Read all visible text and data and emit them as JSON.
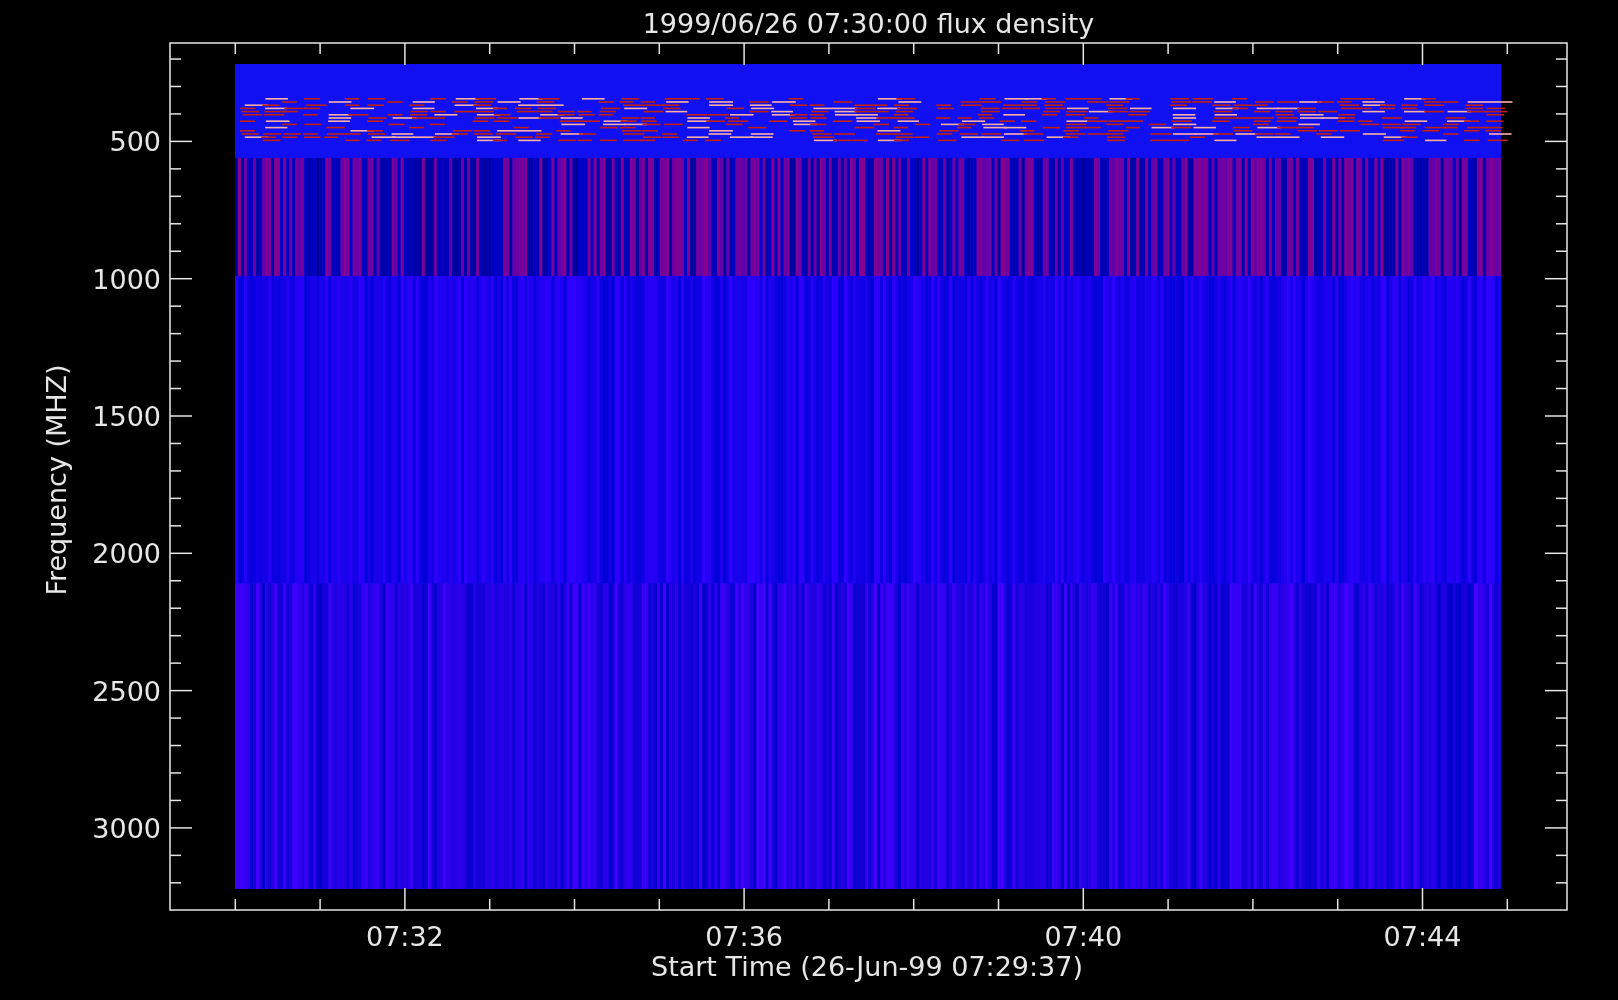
{
  "title": "1999/06/26 07:30:00 flux density",
  "y_axis": {
    "label": "Frequency (MHZ)",
    "ticks": [
      "500",
      "1000",
      "1500",
      "2000",
      "2500",
      "3000"
    ]
  },
  "x_axis": {
    "label": "Start Time (26-Jun-99 07:29:37)",
    "ticks": [
      "07:32",
      "07:36",
      "07:40",
      "07:44"
    ]
  }
}
